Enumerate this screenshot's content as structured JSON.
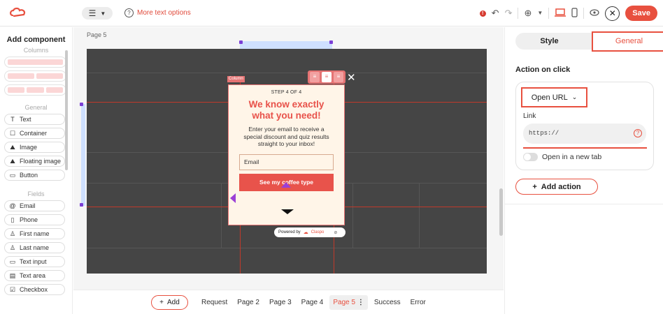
{
  "topbar": {
    "more_text_options": "More text options",
    "save_label": "Save"
  },
  "left_panel": {
    "title": "Add component",
    "columns_heading": "Columns",
    "general_heading": "General",
    "general_items": [
      {
        "label": "Text",
        "icon": "text-icon"
      },
      {
        "label": "Container",
        "icon": "container-icon"
      },
      {
        "label": "Image",
        "icon": "image-icon"
      },
      {
        "label": "Floating image",
        "icon": "floating-image-icon"
      },
      {
        "label": "Button",
        "icon": "button-icon"
      }
    ],
    "fields_heading": "Fields",
    "field_items": [
      {
        "label": "Email",
        "icon": "at-icon"
      },
      {
        "label": "Phone",
        "icon": "phone-icon"
      },
      {
        "label": "First name",
        "icon": "person-icon"
      },
      {
        "label": "Last name",
        "icon": "person-icon"
      },
      {
        "label": "Text input",
        "icon": "text-input-icon"
      },
      {
        "label": "Text area",
        "icon": "text-area-icon"
      },
      {
        "label": "Checkbox",
        "icon": "checkbox-icon"
      }
    ]
  },
  "canvas": {
    "page_label": "Page 5",
    "column_tag": "Column",
    "popup": {
      "step": "STEP 4 OF 4",
      "headline_line1": "We know exactly",
      "headline_line2": "what you need!",
      "body_line1": "Enter your email to receive a",
      "body_line2": "special discount and quiz results",
      "body_line3": "straight to your inbox!",
      "email_placeholder": "Email",
      "cta": "See my coffee type"
    },
    "powered_by": "Powered by",
    "brand": "Claspo"
  },
  "bottom_bar": {
    "add_label": "Add",
    "pages": [
      "Request",
      "Page 2",
      "Page 3",
      "Page 4",
      "Page 5",
      "Success",
      "Error"
    ],
    "active_page": "Page 5"
  },
  "right_panel": {
    "tab_style": "Style",
    "tab_general": "General",
    "section_title": "Action on click",
    "action_value": "Open URL",
    "link_label": "Link",
    "link_placeholder": "https://",
    "new_tab_label": "Open in a new tab",
    "add_action": "Add action"
  },
  "colors": {
    "accent": "#e8503f",
    "canvas_dark": "#454545",
    "popup_bg": "#fff5e8",
    "headline": "#e8524a"
  }
}
